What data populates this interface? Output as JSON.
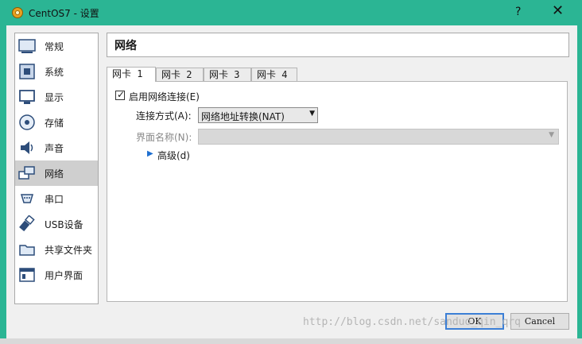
{
  "window": {
    "title": "CentOS7 - 设置",
    "help": "?",
    "close": "✕"
  },
  "sidebar": {
    "items": [
      {
        "label": "常规",
        "icon": "general-icon"
      },
      {
        "label": "系统",
        "icon": "system-icon"
      },
      {
        "label": "显示",
        "icon": "display-icon"
      },
      {
        "label": "存储",
        "icon": "storage-icon"
      },
      {
        "label": "声音",
        "icon": "audio-icon"
      },
      {
        "label": "网络",
        "icon": "network-icon",
        "selected": true
      },
      {
        "label": "串口",
        "icon": "serial-port-icon"
      },
      {
        "label": "USB设备",
        "icon": "usb-icon"
      },
      {
        "label": "共享文件夹",
        "icon": "shared-folder-icon"
      },
      {
        "label": "用户界面",
        "icon": "user-interface-icon"
      }
    ]
  },
  "main": {
    "title": "网络",
    "tabs": [
      "网卡 1",
      "网卡 2",
      "网卡 3",
      "网卡 4"
    ],
    "active_tab": "网卡 1",
    "enable_label": "启用网络连接(E)",
    "enable_checked": true,
    "attached_label": "连接方式(A):",
    "attached_value": "网络地址转换(NAT)",
    "name_label": "界面名称(N):",
    "name_value": "",
    "advanced_label": "高级(d)"
  },
  "buttons": {
    "ok": "OK",
    "cancel": "Cancel"
  },
  "watermark": "http://blog.csdn.net/sanduo_qin_qrq",
  "colors": {
    "titlebar": "#2bb594",
    "selected_item": "#cfcfcf",
    "ok_border": "#3c7fd6"
  }
}
